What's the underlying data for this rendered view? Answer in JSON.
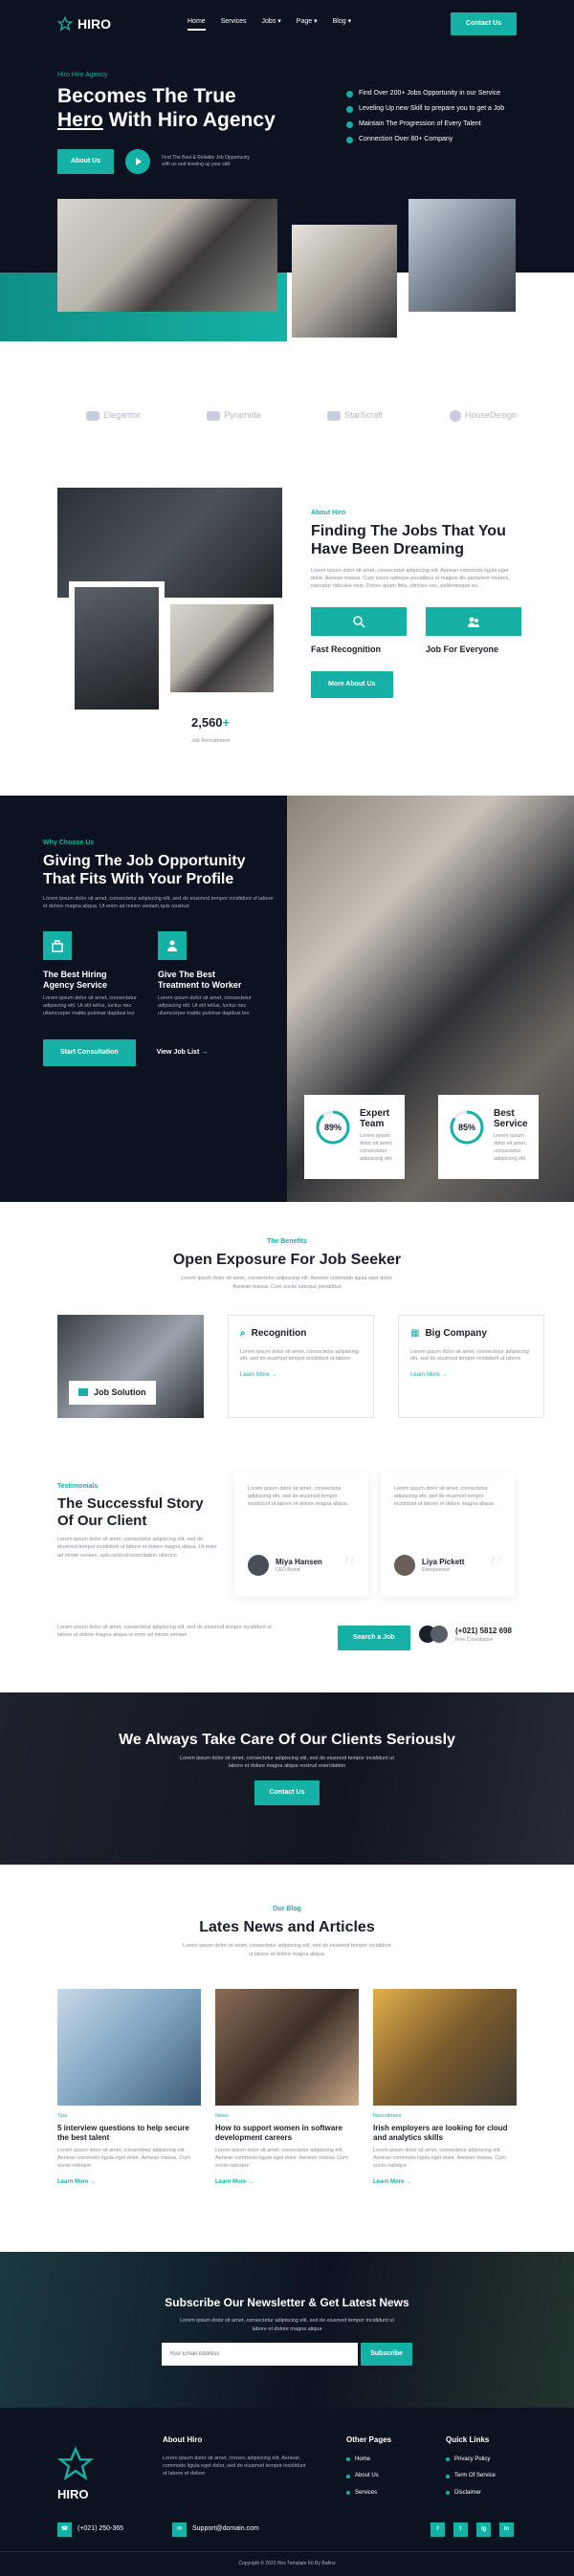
{
  "brand": {
    "name": "HIRO",
    "accent": "#16b1a6",
    "dark": "#0d1220"
  },
  "nav": {
    "items": [
      {
        "label": "Home"
      },
      {
        "label": "Services"
      },
      {
        "label": "Jobs"
      },
      {
        "label": "Page"
      },
      {
        "label": "Blog"
      }
    ],
    "cta": "Contact Us"
  },
  "hero": {
    "tag": "Hiro Hire Agency",
    "title_line1": "Becomes The True",
    "title_hl": "Hero",
    "title_rest": "With Hiro Agency",
    "button": "About Us",
    "video_note": "Find The Best & Reliable Job Opportunity with us and leveling up your skill",
    "checklist": [
      "Find Over 200+ Jobs Opportunity in our Service",
      "Leveling Up new Skill to prepare you to get a Job",
      "Maintain The Progression of Every Talent",
      "Connection Over 80+ Company"
    ]
  },
  "partners": [
    "Elegantor",
    "Pyramida",
    "StarScraft",
    "HouseDesign"
  ],
  "about": {
    "tag": "About Hiro",
    "title": "Finding The Jobs That You Have Been Dreaming",
    "desc": "Lorem ipsum dolor sit amet, consectetur adipiscing elit. Aenean commodo ligula eget dolor. Aenean massa. Cum sociis natoque penatibus et magnis dis parturient montes, nascetur ridiculus mus. Donec quam felis, ultricies nec, pellentesque eu.",
    "features": [
      {
        "title": "Fast Recognition",
        "icon": "user-search-icon"
      },
      {
        "title": "Job For Everyone",
        "icon": "people-icon"
      }
    ],
    "button": "More About Us",
    "stat_value": "2,560",
    "stat_suffix": "+",
    "stat_label": "Job Recruitment"
  },
  "why": {
    "tag": "Why Choose Us",
    "title": "Giving The Job Opportunity That Fits With Your Profile",
    "desc": "Lorem ipsum dolor sit amet, consectetur adipiscing elit, sed do eiusmod tempor incididunt ut labore et dolore magna aliqua. Ut enim ad minim veniam quis nostrud",
    "features": [
      {
        "title": "The Best Hiring Agency Service",
        "desc": "Lorem ipsum dolor sit amet, consectetur adipiscing elit. Ut elit tellus, luctus nec ullamcorper mattis pulvinar dapibus leo"
      },
      {
        "title": "Give The Best Treatment to Worker",
        "desc": "Lorem ipsum dolor sit amet, consectetur adipiscing elit. Ut elit tellus, luctus nec ullamcorper mattis pulvinar dapibus leo"
      }
    ],
    "button": "Start Consultation",
    "link": "View Job List",
    "stats": [
      {
        "value": "89%",
        "pct": 0.89,
        "title": "Expert Team",
        "desc": "Lorem ipsum dolor sit amet, consectetur adipiscing elit."
      },
      {
        "value": "85%",
        "pct": 0.85,
        "title": "Best Service",
        "desc": "Lorem ipsum dolor sit amet, consectetur adipiscing elit."
      }
    ]
  },
  "benefits": {
    "tag": "The Benefits",
    "title": "Open Exposure For Job Seeker",
    "desc": "Lorem ipsum dolor sit amet, consectetur adipiscing elit. Aenean commodo ligula eget dolor. Aenean massa. Cum sociis natoque penatibus",
    "cards": [
      {
        "title": "Job Solution"
      },
      {
        "title": "Recognition",
        "desc": "Lorem ipsum dolor sit amet, consectetur adipiscing elit, sed do eiusmod tempor incididunt ut labore",
        "link": "Learn More"
      },
      {
        "title": "Big Company",
        "desc": "Lorem ipsum dolor sit amet, consectetur adipiscing elit, sed do eiusmod tempor incididunt ut labore",
        "link": "Learn More"
      }
    ]
  },
  "testimonials": {
    "tag": "Testimonials",
    "title": "The Successful Story Of Our Client",
    "desc": "Lorem ipsum dolor sit amet, consectetur adipiscing elit, sed do eiusmod tempor incididunt ut labore et dolore magna aliqua. Ut enim ad minim veniam, quis nostrud exercitation ullamco",
    "items": [
      {
        "quote": "Lorem ipsum dolor sit amet, consectetur adipiscing elit, sed do eiusmod tempor incididunt ut labore et dolore magna aliqua.",
        "name": "Miya Hansen",
        "role": "CEO Brand"
      },
      {
        "quote": "Lorem ipsum dolor sit amet, consectetur adipiscing elit, sed do eiusmod tempor incididunt ut labore et dolore magna aliqua.",
        "name": "Liya Pickett",
        "role": "Entrepreneur"
      }
    ],
    "bottom_desc": "Lorem ipsum dolor sit amet, consectetur adipiscing elit, sed do eiusmod tempor incididunt ut labore et dolore magna aliqua ut enim ad minim veniam",
    "button": "Search a Job",
    "phone": "(+021) 5812 698",
    "phone_label": "Free Consultation"
  },
  "cta": {
    "title": "We Always Take Care Of Our Clients Seriously",
    "desc": "Lorem ipsum dolor sit amet, consectetur adipiscing elit, sed do eiusmod tempor incididunt ut labore et dolore magna aliqua nostrud exercitation",
    "button": "Contact Us"
  },
  "blog": {
    "tag": "Our Blog",
    "title": "Lates News and Articles",
    "desc": "Lorem ipsum dolor sit amet, consectetur adipiscing elit, sed do eiusmod tempor incididunt ut labore et dolore magna aliqua.",
    "posts": [
      {
        "cat": "Tips",
        "title": "5 interview questions to help secure the best talent",
        "desc": "Lorem ipsum dolor sit amet, consectetur adipiscing elit. Aenean commodo ligula eget dolor. Aenean massa. Cum sociis natoque",
        "link": "Learn More"
      },
      {
        "cat": "News",
        "title": "How to support women in software development careers",
        "desc": "Lorem ipsum dolor sit amet, consectetur adipiscing elit. Aenean commodo ligula eget dolor. Aenean massa. Cum sociis natoque",
        "link": "Learn More"
      },
      {
        "cat": "Recruitment",
        "title": "Irish employers are looking for cloud and analytics skills",
        "desc": "Lorem ipsum dolor sit amet, consectetur adipiscing elit. Aenean commodo ligula eget dolor. Aenean massa. Cum sociis natoque",
        "link": "Learn More"
      }
    ]
  },
  "newsletter": {
    "title": "Subscribe Our Newsletter & Get Latest News",
    "desc": "Lorem ipsum dolor sit amet, consectetur adipiscing elit, sed do eiusmod tempor incididunt ut labore et dolore magna aliqua",
    "placeholder": "Your Email Address",
    "button": "Subscribe"
  },
  "footer": {
    "about_title": "About Hiro",
    "about_desc": "Lorem ipsum dolor sit amet, consec adipiscing elit. Aenean commodo ligula eget dolor, sed do eiusmod tempor incididunt ut labore et dolore",
    "other_title": "Other Pages",
    "other_links": [
      "Home",
      "About Us",
      "Services"
    ],
    "quick_title": "Quick Links",
    "quick_links": [
      "Privacy Policy",
      "Term Of Service",
      "Disclaimer"
    ],
    "phone": "(+021) 250-365",
    "email": "Support@domain.com",
    "social": [
      "f",
      "t",
      "ig",
      "in"
    ],
    "copyright": "Copyright © 2023 Hiro Template Kit By Bafino"
  }
}
